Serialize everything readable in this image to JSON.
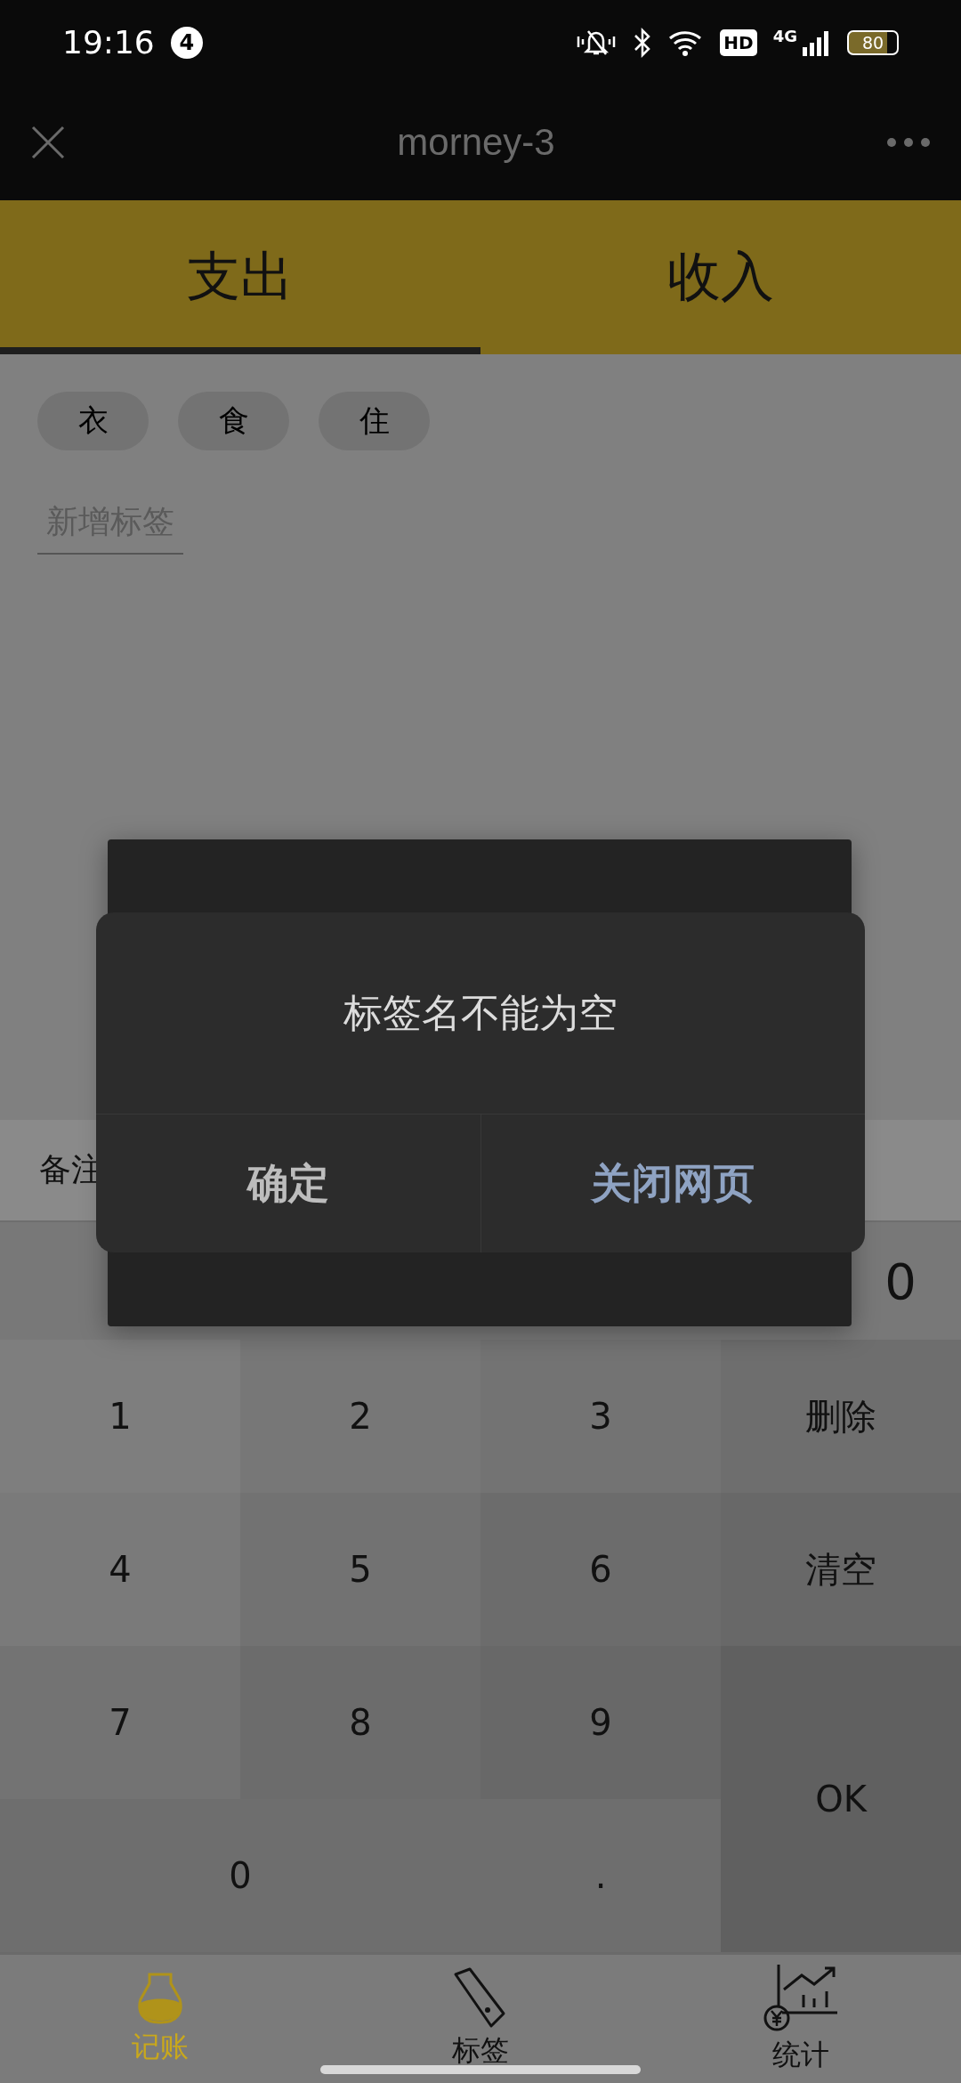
{
  "status_bar": {
    "time": "19:16",
    "notification_count": "4",
    "hd_badge": "HD",
    "network": "4G",
    "battery": "80"
  },
  "header": {
    "title": "morney-3"
  },
  "type_tabs": [
    {
      "label": "支出",
      "selected": true
    },
    {
      "label": "收入",
      "selected": false
    }
  ],
  "tags": [
    {
      "label": "衣"
    },
    {
      "label": "食"
    },
    {
      "label": "住"
    }
  ],
  "new_tag_button": "新增标签",
  "notes": {
    "label": "备注"
  },
  "amount": "0",
  "keypad": [
    {
      "label": "1",
      "kind": "key"
    },
    {
      "label": "2",
      "kind": "key"
    },
    {
      "label": "3",
      "kind": "key"
    },
    {
      "label": "删除",
      "kind": "key"
    },
    {
      "label": "4",
      "kind": "key"
    },
    {
      "label": "5",
      "kind": "key"
    },
    {
      "label": "6",
      "kind": "key"
    },
    {
      "label": "清空",
      "kind": "key"
    },
    {
      "label": "7",
      "kind": "key"
    },
    {
      "label": "8",
      "kind": "key"
    },
    {
      "label": "9",
      "kind": "key"
    },
    {
      "label": "OK",
      "kind": "tall"
    },
    {
      "label": "0",
      "kind": "wide"
    },
    {
      "label": ".",
      "kind": "key"
    }
  ],
  "alert_dialog": {
    "message": "标签名不能为空",
    "buttons": [
      {
        "label": "确定",
        "kind": "default"
      },
      {
        "label": "关闭网页",
        "kind": "primary"
      }
    ]
  },
  "bottom_nav": [
    {
      "label": "记账",
      "selected": true
    },
    {
      "label": "标签",
      "selected": false
    },
    {
      "label": "统计",
      "selected": false
    }
  ]
}
